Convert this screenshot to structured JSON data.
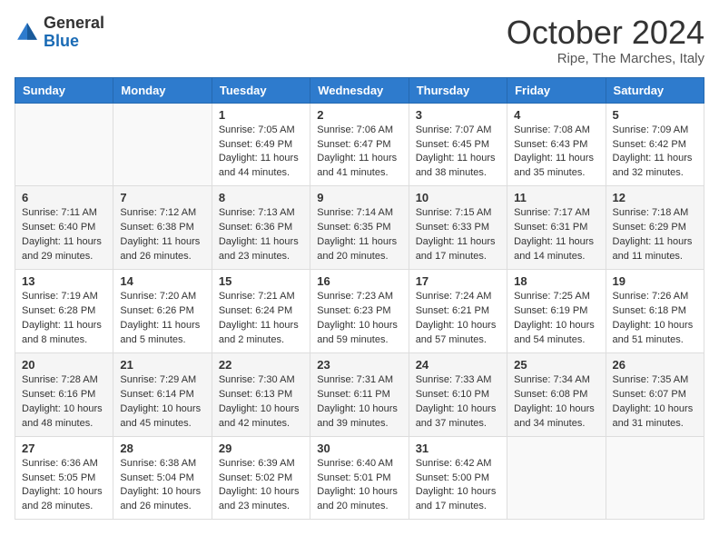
{
  "header": {
    "logo_general": "General",
    "logo_blue": "Blue",
    "month_title": "October 2024",
    "location": "Ripe, The Marches, Italy"
  },
  "days_of_week": [
    "Sunday",
    "Monday",
    "Tuesday",
    "Wednesday",
    "Thursday",
    "Friday",
    "Saturday"
  ],
  "weeks": [
    [
      {
        "day": "",
        "sunrise": "",
        "sunset": "",
        "daylight": ""
      },
      {
        "day": "",
        "sunrise": "",
        "sunset": "",
        "daylight": ""
      },
      {
        "day": "1",
        "sunrise": "Sunrise: 7:05 AM",
        "sunset": "Sunset: 6:49 PM",
        "daylight": "Daylight: 11 hours and 44 minutes."
      },
      {
        "day": "2",
        "sunrise": "Sunrise: 7:06 AM",
        "sunset": "Sunset: 6:47 PM",
        "daylight": "Daylight: 11 hours and 41 minutes."
      },
      {
        "day": "3",
        "sunrise": "Sunrise: 7:07 AM",
        "sunset": "Sunset: 6:45 PM",
        "daylight": "Daylight: 11 hours and 38 minutes."
      },
      {
        "day": "4",
        "sunrise": "Sunrise: 7:08 AM",
        "sunset": "Sunset: 6:43 PM",
        "daylight": "Daylight: 11 hours and 35 minutes."
      },
      {
        "day": "5",
        "sunrise": "Sunrise: 7:09 AM",
        "sunset": "Sunset: 6:42 PM",
        "daylight": "Daylight: 11 hours and 32 minutes."
      }
    ],
    [
      {
        "day": "6",
        "sunrise": "Sunrise: 7:11 AM",
        "sunset": "Sunset: 6:40 PM",
        "daylight": "Daylight: 11 hours and 29 minutes."
      },
      {
        "day": "7",
        "sunrise": "Sunrise: 7:12 AM",
        "sunset": "Sunset: 6:38 PM",
        "daylight": "Daylight: 11 hours and 26 minutes."
      },
      {
        "day": "8",
        "sunrise": "Sunrise: 7:13 AM",
        "sunset": "Sunset: 6:36 PM",
        "daylight": "Daylight: 11 hours and 23 minutes."
      },
      {
        "day": "9",
        "sunrise": "Sunrise: 7:14 AM",
        "sunset": "Sunset: 6:35 PM",
        "daylight": "Daylight: 11 hours and 20 minutes."
      },
      {
        "day": "10",
        "sunrise": "Sunrise: 7:15 AM",
        "sunset": "Sunset: 6:33 PM",
        "daylight": "Daylight: 11 hours and 17 minutes."
      },
      {
        "day": "11",
        "sunrise": "Sunrise: 7:17 AM",
        "sunset": "Sunset: 6:31 PM",
        "daylight": "Daylight: 11 hours and 14 minutes."
      },
      {
        "day": "12",
        "sunrise": "Sunrise: 7:18 AM",
        "sunset": "Sunset: 6:29 PM",
        "daylight": "Daylight: 11 hours and 11 minutes."
      }
    ],
    [
      {
        "day": "13",
        "sunrise": "Sunrise: 7:19 AM",
        "sunset": "Sunset: 6:28 PM",
        "daylight": "Daylight: 11 hours and 8 minutes."
      },
      {
        "day": "14",
        "sunrise": "Sunrise: 7:20 AM",
        "sunset": "Sunset: 6:26 PM",
        "daylight": "Daylight: 11 hours and 5 minutes."
      },
      {
        "day": "15",
        "sunrise": "Sunrise: 7:21 AM",
        "sunset": "Sunset: 6:24 PM",
        "daylight": "Daylight: 11 hours and 2 minutes."
      },
      {
        "day": "16",
        "sunrise": "Sunrise: 7:23 AM",
        "sunset": "Sunset: 6:23 PM",
        "daylight": "Daylight: 10 hours and 59 minutes."
      },
      {
        "day": "17",
        "sunrise": "Sunrise: 7:24 AM",
        "sunset": "Sunset: 6:21 PM",
        "daylight": "Daylight: 10 hours and 57 minutes."
      },
      {
        "day": "18",
        "sunrise": "Sunrise: 7:25 AM",
        "sunset": "Sunset: 6:19 PM",
        "daylight": "Daylight: 10 hours and 54 minutes."
      },
      {
        "day": "19",
        "sunrise": "Sunrise: 7:26 AM",
        "sunset": "Sunset: 6:18 PM",
        "daylight": "Daylight: 10 hours and 51 minutes."
      }
    ],
    [
      {
        "day": "20",
        "sunrise": "Sunrise: 7:28 AM",
        "sunset": "Sunset: 6:16 PM",
        "daylight": "Daylight: 10 hours and 48 minutes."
      },
      {
        "day": "21",
        "sunrise": "Sunrise: 7:29 AM",
        "sunset": "Sunset: 6:14 PM",
        "daylight": "Daylight: 10 hours and 45 minutes."
      },
      {
        "day": "22",
        "sunrise": "Sunrise: 7:30 AM",
        "sunset": "Sunset: 6:13 PM",
        "daylight": "Daylight: 10 hours and 42 minutes."
      },
      {
        "day": "23",
        "sunrise": "Sunrise: 7:31 AM",
        "sunset": "Sunset: 6:11 PM",
        "daylight": "Daylight: 10 hours and 39 minutes."
      },
      {
        "day": "24",
        "sunrise": "Sunrise: 7:33 AM",
        "sunset": "Sunset: 6:10 PM",
        "daylight": "Daylight: 10 hours and 37 minutes."
      },
      {
        "day": "25",
        "sunrise": "Sunrise: 7:34 AM",
        "sunset": "Sunset: 6:08 PM",
        "daylight": "Daylight: 10 hours and 34 minutes."
      },
      {
        "day": "26",
        "sunrise": "Sunrise: 7:35 AM",
        "sunset": "Sunset: 6:07 PM",
        "daylight": "Daylight: 10 hours and 31 minutes."
      }
    ],
    [
      {
        "day": "27",
        "sunrise": "Sunrise: 6:36 AM",
        "sunset": "Sunset: 5:05 PM",
        "daylight": "Daylight: 10 hours and 28 minutes."
      },
      {
        "day": "28",
        "sunrise": "Sunrise: 6:38 AM",
        "sunset": "Sunset: 5:04 PM",
        "daylight": "Daylight: 10 hours and 26 minutes."
      },
      {
        "day": "29",
        "sunrise": "Sunrise: 6:39 AM",
        "sunset": "Sunset: 5:02 PM",
        "daylight": "Daylight: 10 hours and 23 minutes."
      },
      {
        "day": "30",
        "sunrise": "Sunrise: 6:40 AM",
        "sunset": "Sunset: 5:01 PM",
        "daylight": "Daylight: 10 hours and 20 minutes."
      },
      {
        "day": "31",
        "sunrise": "Sunrise: 6:42 AM",
        "sunset": "Sunset: 5:00 PM",
        "daylight": "Daylight: 10 hours and 17 minutes."
      },
      {
        "day": "",
        "sunrise": "",
        "sunset": "",
        "daylight": ""
      },
      {
        "day": "",
        "sunrise": "",
        "sunset": "",
        "daylight": ""
      }
    ]
  ]
}
